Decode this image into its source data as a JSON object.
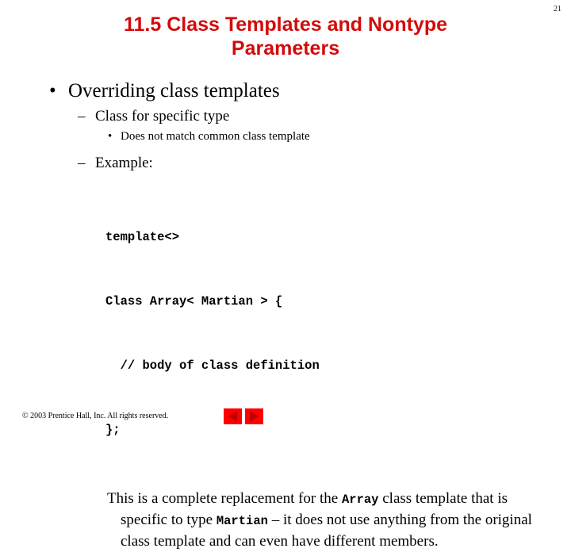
{
  "slide": {
    "page_number": "21",
    "title_line_1": "11.5  Class Templates and Nontype",
    "title_line_2": "Parameters",
    "title_color": "#D20B0B",
    "background_color": "#FFFFFF"
  },
  "content": {
    "bullet_glyph": "•",
    "dash_glyph": "–",
    "level1": "Overriding class templates",
    "level2_a": "Class for specific type",
    "level3_a": "Does not match common class template",
    "level2_b": "Example:",
    "code": {
      "line1": "template<>",
      "line2": "Class Array< Martian > {",
      "line3": "  // body of class definition",
      "line4": "};"
    },
    "paragraph": {
      "part1": "This is a complete replacement for the ",
      "mono1": "Array",
      "part2": " class template that is specific to type ",
      "mono2": "Martian",
      "part3": " – it does not use anything from the original class template and can even have different members."
    }
  },
  "footer": {
    "copyright": "© 2003 Prentice Hall, Inc.  All rights reserved.",
    "nav": {
      "prev_label": "Previous slide",
      "next_label": "Next slide",
      "button_color": "#FF0000",
      "arrow_color": "#BE0000"
    }
  }
}
